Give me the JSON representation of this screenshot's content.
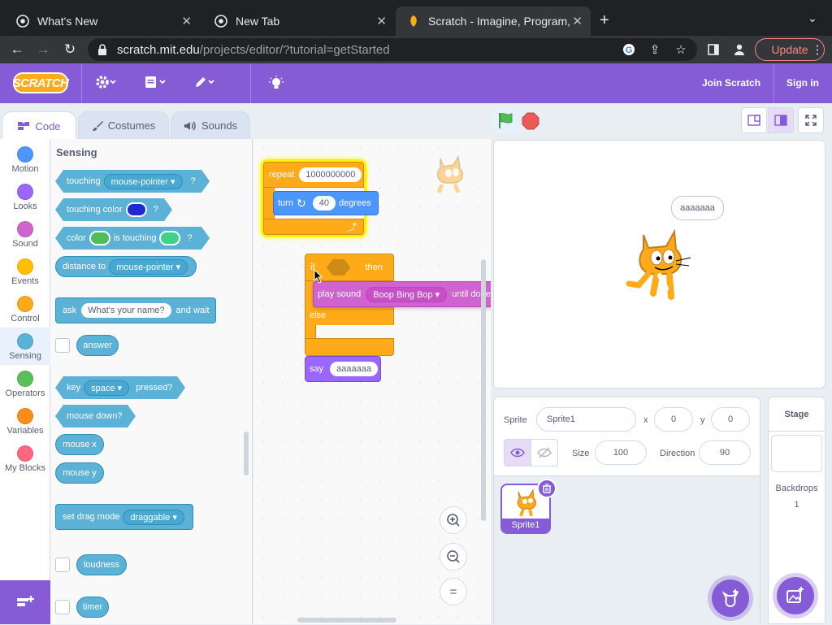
{
  "browser": {
    "tabs": [
      {
        "title": "What's New"
      },
      {
        "title": "New Tab"
      },
      {
        "title": "Scratch - Imagine, Program, Sh"
      }
    ],
    "url_domain": "scratch.mit.edu",
    "url_path": "/projects/editor/?tutorial=getStarted",
    "update_label": "Update"
  },
  "menu": {
    "logo_text": "SCRATCH",
    "join_label": "Join Scratch",
    "signin_label": "Sign in"
  },
  "editor_tabs": [
    "Code",
    "Costumes",
    "Sounds"
  ],
  "categories": [
    {
      "label": "Motion",
      "color": "#4c97ff"
    },
    {
      "label": "Looks",
      "color": "#9966ff"
    },
    {
      "label": "Sound",
      "color": "#cf63cf"
    },
    {
      "label": "Events",
      "color": "#ffbf00"
    },
    {
      "label": "Control",
      "color": "#ffab19"
    },
    {
      "label": "Sensing",
      "color": "#5cb1d6"
    },
    {
      "label": "Operators",
      "color": "#59c059"
    },
    {
      "label": "Variables",
      "color": "#ff8c1a"
    },
    {
      "label": "My Blocks",
      "color": "#ff6680"
    }
  ],
  "palette": {
    "title": "Sensing",
    "touching": {
      "label": "touching",
      "dropdown": "mouse-pointer",
      "suffix": "?"
    },
    "touching_color": {
      "label": "touching color",
      "suffix": "?",
      "swatch": "#1d2bd0"
    },
    "color_touching": {
      "label1": "color",
      "label2": "is touching",
      "suffix": "?",
      "swatch1": "#4cbf56",
      "swatch2": "#3ed28a"
    },
    "distance_to": {
      "label": "distance to",
      "dropdown": "mouse-pointer"
    },
    "ask": {
      "label": "ask",
      "input": "What's your name?",
      "suffix": "and wait"
    },
    "answer": "answer",
    "key_pressed": {
      "label": "key",
      "dropdown": "space",
      "suffix": "pressed?"
    },
    "mouse_down": "mouse down?",
    "mouse_x": "mouse x",
    "mouse_y": "mouse y",
    "drag_mode": {
      "label": "set drag mode",
      "dropdown": "draggable"
    },
    "loudness": "loudness",
    "timer": "timer"
  },
  "script": {
    "repeat_label": "repeat",
    "repeat_count": "1000000000",
    "turn_label": "turn",
    "turn_degrees": "40",
    "degrees_label": "degrees",
    "if_label": "if",
    "then_label": "then",
    "else_label": "else",
    "play_sound_label": "play sound",
    "sound_name": "Boop Bing Bop",
    "until_done_label": "until done",
    "say_label": "say",
    "say_text": "aaaaaaa"
  },
  "stage": {
    "speech_bubble": "aaaaaaa"
  },
  "sprite_info": {
    "sprite_label": "Sprite",
    "sprite_name": "Sprite1",
    "x_label": "x",
    "x_value": "0",
    "y_label": "y",
    "y_value": "0",
    "size_label": "Size",
    "size_value": "100",
    "direction_label": "Direction",
    "direction_value": "90"
  },
  "sprites": [
    {
      "name": "Sprite1"
    }
  ],
  "stage_target": {
    "title": "Stage",
    "backdrops_label": "Backdrops",
    "backdrops_count": "1"
  }
}
